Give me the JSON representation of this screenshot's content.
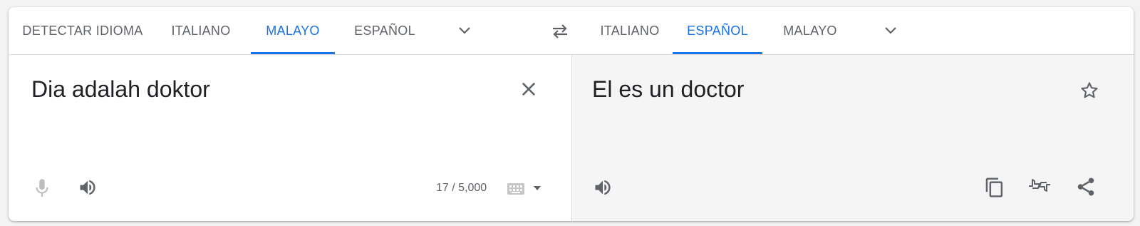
{
  "source_tabs": [
    "Detectar idioma",
    "Italiano",
    "Malayo",
    "Español"
  ],
  "target_tabs": [
    "Italiano",
    "Español",
    "Malayo"
  ],
  "active_source": "Malayo",
  "active_target": "Español",
  "source_text": "Dia adalah doktor",
  "translated_text": "El es un doctor",
  "char_count": "17 / 5,000",
  "icons": {
    "source_more": "chevron-down-icon",
    "swap": "swap-languages-icon",
    "target_more": "chevron-down-icon",
    "clear": "close-icon",
    "mic": "microphone-icon",
    "listen_source": "speaker-icon",
    "keyboard": "keyboard-icon",
    "star": "star-icon",
    "listen_target": "speaker-icon",
    "copy": "copy-icon",
    "feedback": "thumbs-feedback-icon",
    "share": "share-icon"
  },
  "colors": {
    "accent": "#1a73e8",
    "text": "#202124",
    "muted": "#5f6368"
  }
}
